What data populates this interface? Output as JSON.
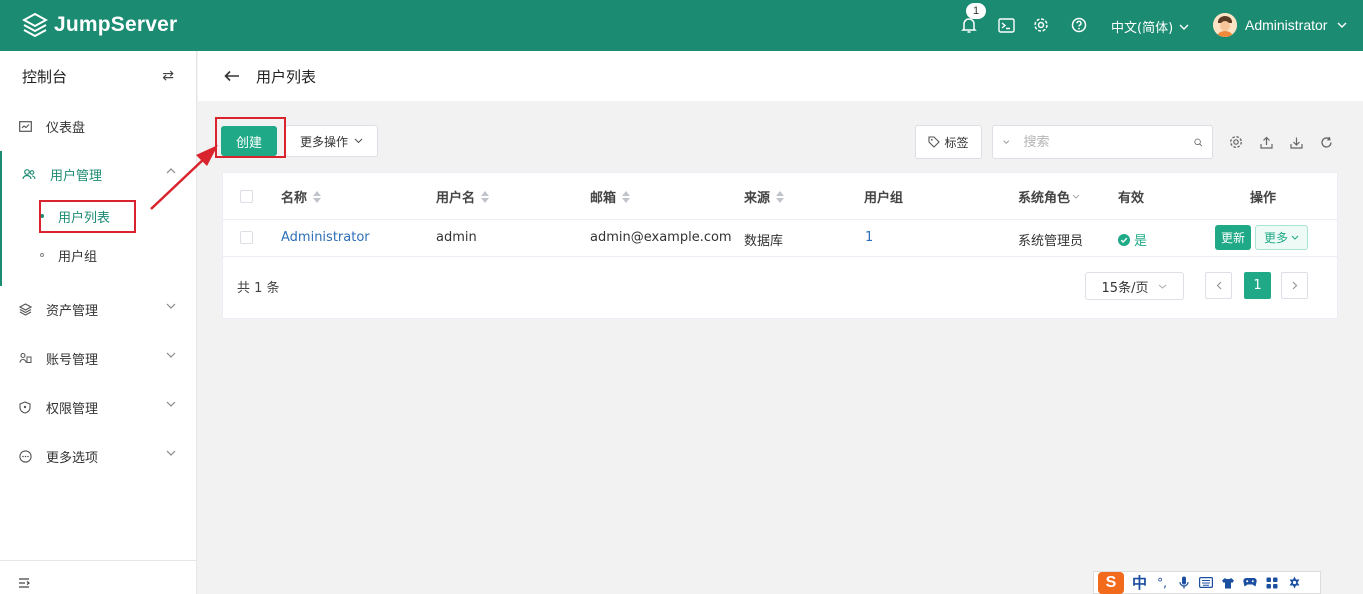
{
  "app": {
    "name": "JumpServer"
  },
  "header": {
    "notification_count": "1",
    "language": "中文(简体)",
    "user_name": "Administrator"
  },
  "sidebar": {
    "title": "控制台",
    "items": [
      {
        "label": "仪表盘"
      },
      {
        "label": "用户管理",
        "children": [
          {
            "label": "用户列表"
          },
          {
            "label": "用户组"
          }
        ]
      },
      {
        "label": "资产管理"
      },
      {
        "label": "账号管理"
      },
      {
        "label": "权限管理"
      },
      {
        "label": "更多选项"
      }
    ]
  },
  "page": {
    "title": "用户列表"
  },
  "toolbar": {
    "create_label": "创建",
    "more_actions_label": "更多操作",
    "tags_label": "标签",
    "search_placeholder": "搜索"
  },
  "table": {
    "columns": [
      "名称",
      "用户名",
      "邮箱",
      "来源",
      "用户组",
      "系统角色",
      "有效",
      "操作"
    ],
    "rows": [
      {
        "name": "Administrator",
        "username": "admin",
        "email": "admin@example.com",
        "source": "数据库",
        "groups": "1",
        "role": "系统管理员",
        "valid": "是",
        "update_label": "更新",
        "more_label": "更多"
      }
    ]
  },
  "pagination": {
    "total_text": "共 1 条",
    "page_size": "15条/页",
    "current_page": "1"
  },
  "ime": {
    "mode": "中"
  },
  "colors": {
    "brand": "#1b8b72",
    "primary_button": "#1fa986",
    "annotation_red": "#d9232d"
  }
}
